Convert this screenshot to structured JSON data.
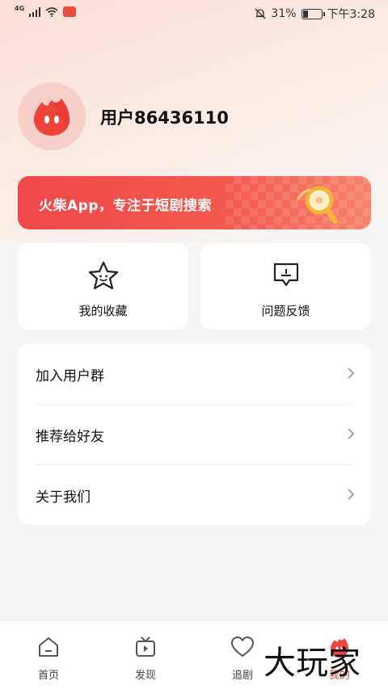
{
  "status_bar": {
    "network": "4G",
    "battery_percent": "31%",
    "battery_level": 0.31,
    "time": "下午3:28"
  },
  "profile": {
    "username": "用户86436110"
  },
  "banner": {
    "text": "火柴App，专注于短剧搜索"
  },
  "cards": {
    "favorites": "我的收藏",
    "feedback": "问题反馈"
  },
  "menu": {
    "items": [
      {
        "label": "加入用户群"
      },
      {
        "label": "推荐给好友"
      },
      {
        "label": "关于我们"
      }
    ]
  },
  "bottom_nav": {
    "items": [
      {
        "label": "首页",
        "icon": "home-icon"
      },
      {
        "label": "发现",
        "icon": "tv-icon"
      },
      {
        "label": "追剧",
        "icon": "heart-icon"
      },
      {
        "label": "我的",
        "icon": "flame-mascot-icon",
        "active": true
      }
    ]
  },
  "watermark": "大玩家",
  "colors": {
    "accent": "#f0443b",
    "banner_start": "#f04848",
    "banner_end": "#f7836a",
    "avatar_bg": "#f6cfc8"
  }
}
